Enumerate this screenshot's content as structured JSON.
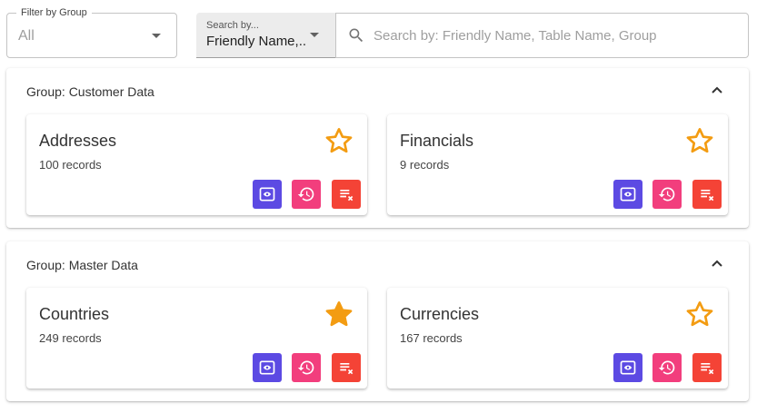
{
  "filter": {
    "label": "Filter by Group",
    "value": "All"
  },
  "search_by": {
    "label": "Search by...",
    "value": "Friendly Name,..."
  },
  "search": {
    "placeholder": "Search by: Friendly Name, Table Name, Group",
    "value": ""
  },
  "groups": [
    {
      "title": "Group: Customer Data",
      "cards": [
        {
          "title": "Addresses",
          "count": "100",
          "unit": "records",
          "favorite": false
        },
        {
          "title": "Financials",
          "count": "9",
          "unit": "records",
          "favorite": false
        }
      ]
    },
    {
      "title": "Group: Master Data",
      "cards": [
        {
          "title": "Countries",
          "count": "249",
          "unit": "records",
          "favorite": true
        },
        {
          "title": "Currencies",
          "count": "167",
          "unit": "records",
          "favorite": false
        }
      ]
    }
  ],
  "colors": {
    "star": "#f39c12",
    "view_button": "#5c4ae3",
    "history_button": "#f23e7d",
    "clear_button": "#f44336"
  },
  "icons": {
    "star": "star-icon",
    "view": "eye-icon",
    "history": "history-icon",
    "clear": "clear-list-icon",
    "search": "search-icon",
    "collapse": "chevron-up-icon",
    "dropdown": "caret-down-icon"
  }
}
